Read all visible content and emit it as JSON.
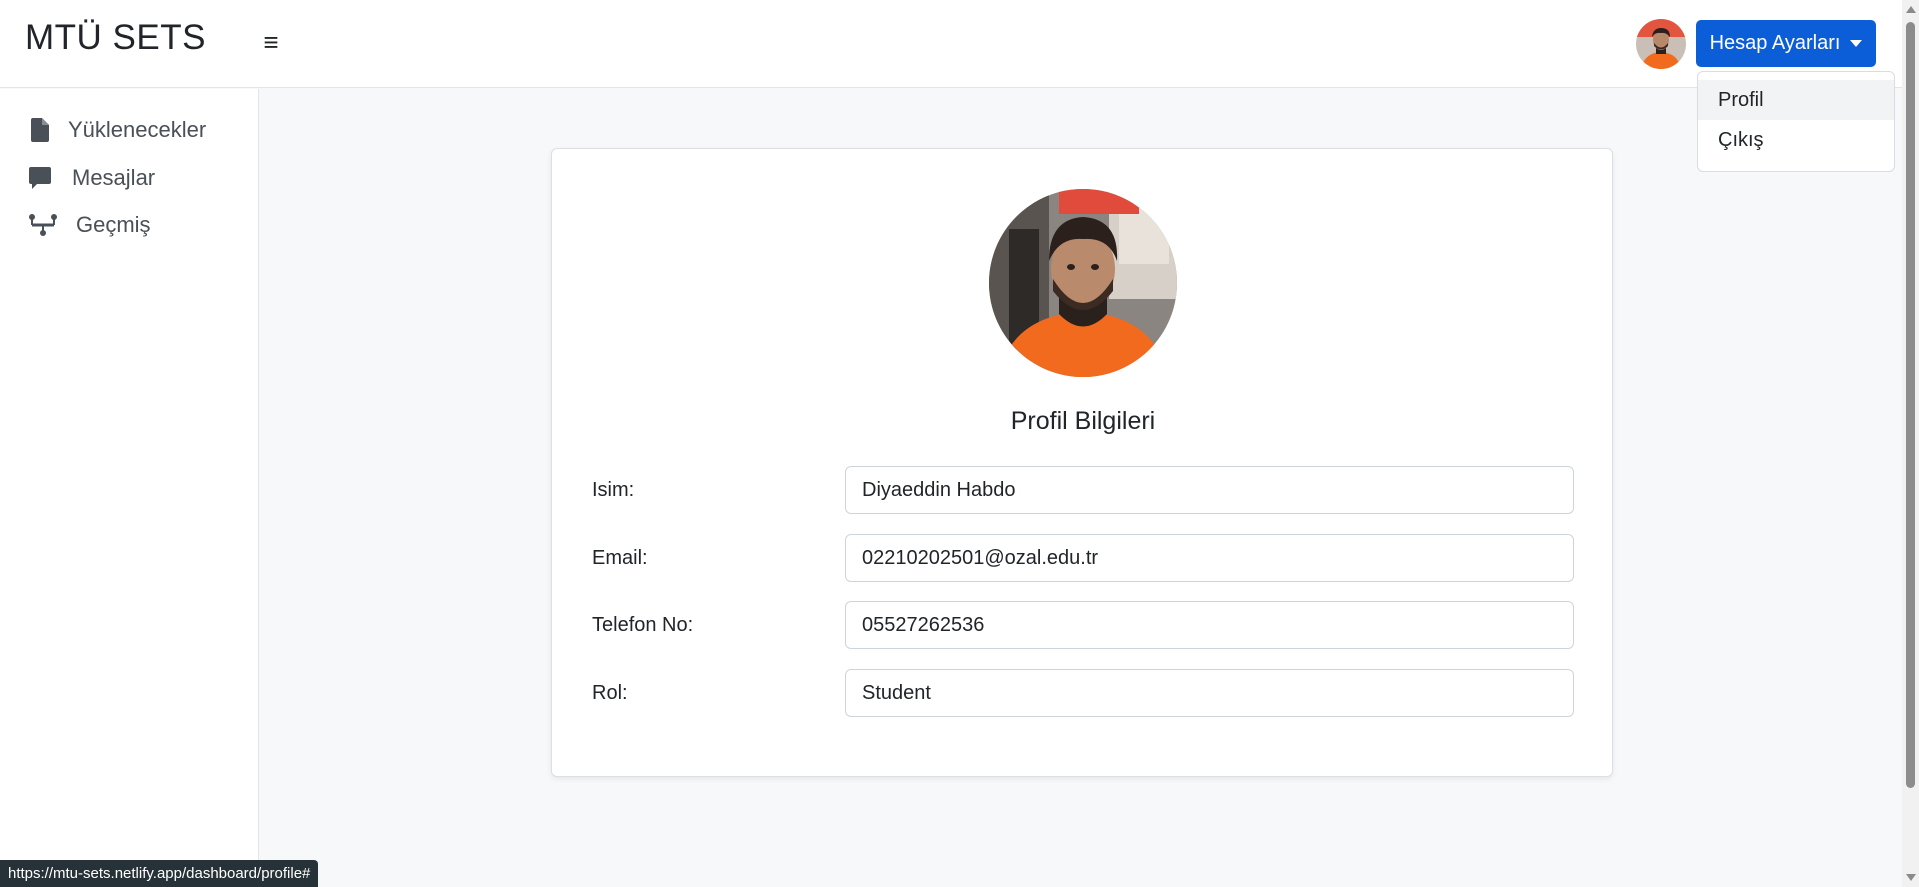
{
  "header": {
    "brand": "MTÜ SETS",
    "menu_icon": "hamburger-icon",
    "account_button_label": "Hesap Ayarları",
    "account_menu": {
      "items": [
        {
          "label": "Profil",
          "active": true
        },
        {
          "label": "Çıkış",
          "active": false
        }
      ]
    }
  },
  "sidebar": {
    "items": [
      {
        "label": "Yüklenecekler",
        "icon": "file-icon"
      },
      {
        "label": "Mesajlar",
        "icon": "message-icon"
      },
      {
        "label": "Geçmiş",
        "icon": "history-icon"
      }
    ]
  },
  "profile": {
    "title": "Profil Bilgileri",
    "fields": [
      {
        "label": "Isim:",
        "value": "Diyaeddin Habdo"
      },
      {
        "label": "Email:",
        "value": "02210202501@ozal.edu.tr"
      },
      {
        "label": "Telefon No:",
        "value": "05527262536"
      },
      {
        "label": "Rol:",
        "value": "Student"
      }
    ]
  },
  "status_bar": {
    "url": "https://mtu-sets.netlify.app/dashboard/profile#"
  },
  "colors": {
    "primary": "#0b5ed7",
    "background": "#f7f8fa",
    "avatar_shirt": "#f26a1d"
  }
}
